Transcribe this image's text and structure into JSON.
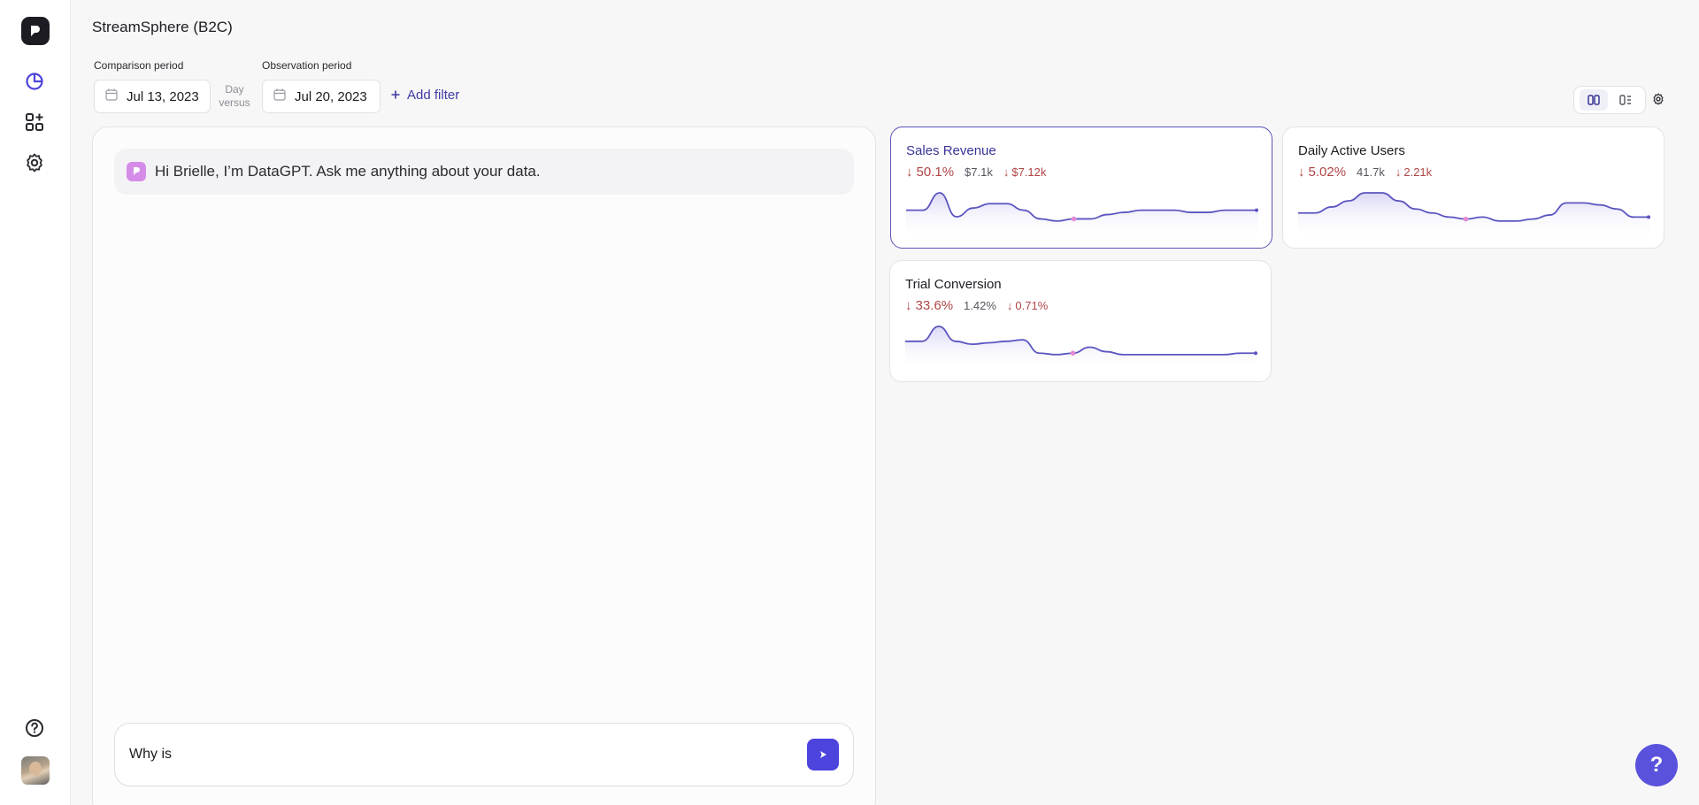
{
  "app": {
    "title": "StreamSphere (B2C)"
  },
  "sidebar": {
    "icons": [
      "logo-icon",
      "analytics-icon",
      "widgets-icon",
      "settings-icon",
      "help-circle-icon"
    ],
    "avatar": "avatar"
  },
  "filters": {
    "comparison_label": "Comparison period",
    "comparison_date": "Jul 13, 2023",
    "versus_top": "Day",
    "versus_bottom": "versus",
    "observation_label": "Observation period",
    "observation_date": "Jul 20, 2023",
    "add_filter_label": "Add filter"
  },
  "chat": {
    "greeting": "Hi Brielle, I’m DataGPT. Ask me anything about your data.",
    "input_value": "Why is "
  },
  "kpis": [
    {
      "title": "Sales Revenue",
      "pct": "50.1%",
      "value": "$7.1k",
      "delta": "$7.12k",
      "selected": true,
      "series": [
        40,
        40,
        48,
        37,
        41,
        43,
        43,
        40,
        36,
        35,
        36,
        36,
        38,
        39,
        40,
        40,
        40,
        39,
        39,
        40,
        40,
        40
      ]
    },
    {
      "title": "Daily Active Users",
      "pct": "5.02%",
      "value": "41.7k",
      "delta": "2.21k",
      "selected": false,
      "series": [
        44,
        44,
        44.3,
        44.6,
        45,
        45,
        44.6,
        44.2,
        44,
        43.8,
        43.7,
        43.8,
        43.6,
        43.6,
        43.7,
        43.9,
        44.5,
        44.5,
        44.4,
        44.2,
        43.8,
        43.8
      ]
    },
    {
      "title": "Trial Conversion",
      "pct": "33.6%",
      "value": "1.42%",
      "delta": "0.71%",
      "selected": false,
      "series": [
        40,
        40,
        45,
        40,
        39,
        39.5,
        40,
        40.5,
        36,
        35.5,
        36,
        38,
        36.5,
        35.5,
        35.5,
        35.5,
        35.5,
        35.5,
        35.5,
        35.5,
        36,
        36
      ]
    }
  ],
  "colors": {
    "accent": "#4d43dd",
    "line": "#5b55c0",
    "negative": "#b04545",
    "marker": "#e48ad4"
  },
  "help_label": "?"
}
